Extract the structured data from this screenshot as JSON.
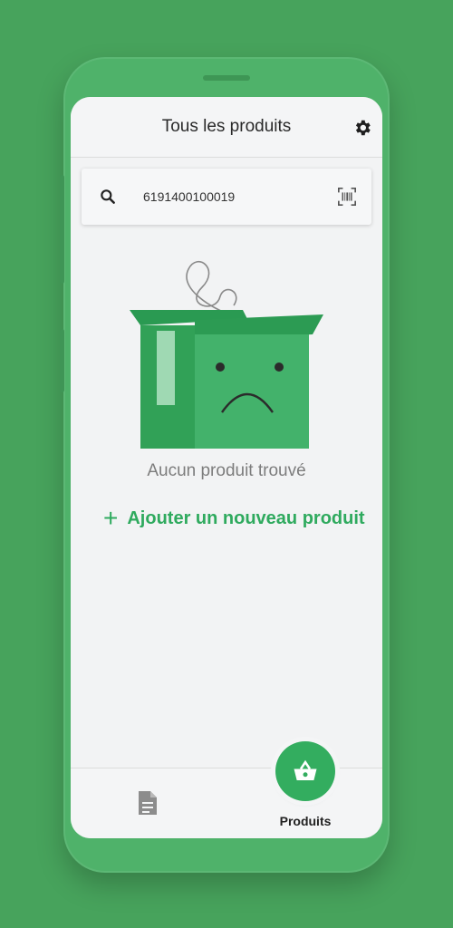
{
  "header": {
    "title": "Tous les produits",
    "settings_icon": "gear-icon"
  },
  "search": {
    "value": "6191400100019",
    "search_icon": "search-icon",
    "scan_icon": "barcode-scan-icon"
  },
  "empty_state": {
    "illustration": "sad-open-box",
    "message": "Aucun produit trouvé",
    "add_icon": "plus-icon",
    "add_label": "Ajouter un nouveau produit"
  },
  "bottom_nav": {
    "items": [
      {
        "icon": "document-icon",
        "label": ""
      },
      {
        "icon": "basket-icon",
        "label": "Produits",
        "active": true
      }
    ]
  },
  "colors": {
    "background": "#47a35c",
    "accent": "#33ad5f",
    "screen": "#f2f3f4"
  }
}
